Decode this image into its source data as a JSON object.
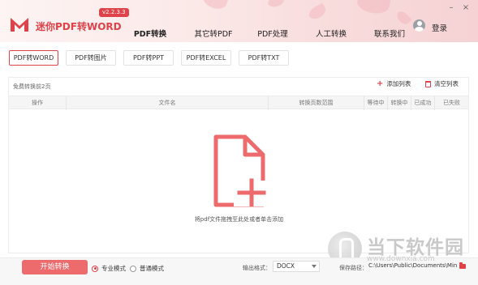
{
  "app": {
    "name": "迷你PDF转WORD",
    "version": "v2.2.3.3",
    "login": "登录"
  },
  "nav": {
    "items": [
      {
        "label": "PDF转换",
        "active": true
      },
      {
        "label": "其它转PDF",
        "active": false
      },
      {
        "label": "PDF处理",
        "active": false
      },
      {
        "label": "人工转换",
        "active": false
      },
      {
        "label": "联系我们",
        "active": false
      }
    ]
  },
  "conversion_tabs": [
    {
      "label": "PDF转WORD",
      "active": true
    },
    {
      "label": "PDF转图片",
      "active": false
    },
    {
      "label": "PDF转PPT",
      "active": false
    },
    {
      "label": "PDF转EXCEL",
      "active": false
    },
    {
      "label": "PDF转TXT",
      "active": false
    }
  ],
  "list": {
    "free_note": "免费转换前2页",
    "add_label": "添加列表",
    "clear_label": "清空列表",
    "columns": [
      "操作",
      "文件名",
      "转换页数范围",
      "等待中",
      "转换中",
      "已成功",
      "已失败"
    ],
    "drop_hint": "将pdf文件拖拽至此处或者单击添加"
  },
  "footer": {
    "start_label": "开始转换",
    "mode_pro": "专业模式",
    "mode_normal": "普通模式",
    "format_label": "输出格式：",
    "format_value": "DOCX",
    "path_label": "保存路径：",
    "path_value": "C:\\Users\\Public\\Documents\\Mini"
  },
  "watermark": {
    "text": "当下软件园",
    "url": "www.downxia.com"
  },
  "colors": {
    "accent": "#e0424a",
    "start_button": "#ee6b6d",
    "header_bg": "#fbe9e8"
  }
}
